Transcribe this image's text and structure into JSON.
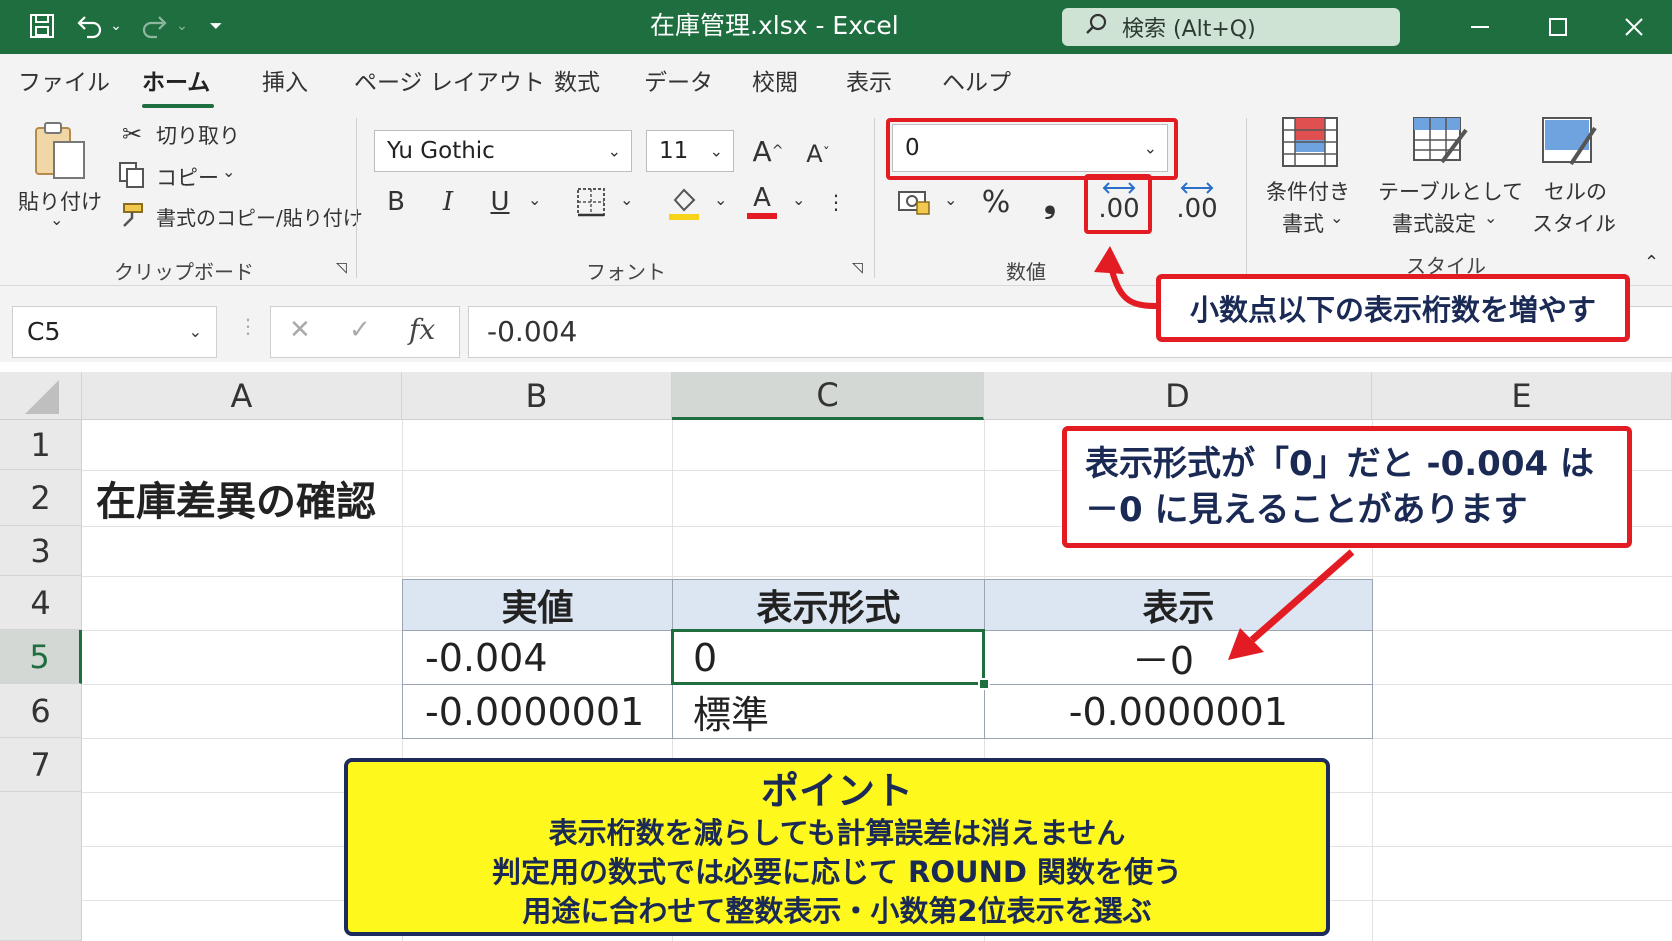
{
  "titlebar": {
    "title": "在庫管理.xlsx  -  Excel",
    "search_label": "検索 (Alt+Q)",
    "icons": [
      "save-icon",
      "undo-icon",
      "redo-icon",
      "customize-icon",
      "search-icon",
      "minimize-icon",
      "maximize-icon",
      "close-icon"
    ]
  },
  "tabs": [
    "ファイル",
    "ホーム",
    "挿入",
    "ページ レイアウト",
    "数式",
    "データ",
    "校閲",
    "表示",
    "ヘルプ"
  ],
  "ribbon": {
    "clipboard": {
      "paste": "貼り付け",
      "cut": "切り取り",
      "copy": "コピー",
      "format_painter": "書式のコピー/貼り付け",
      "group": "クリップボード"
    },
    "font": {
      "font_name": "Yu Gothic",
      "font_size": "11",
      "group": "フォント",
      "bold": "B",
      "italic": "I",
      "underline": "U"
    },
    "number": {
      "format_value": "0",
      "percent": "%",
      "comma": "❟",
      "increase_decimal": ".00",
      "decrease_decimal": ".00",
      "group": "数値"
    },
    "styles": {
      "conditional_line1": "条件付き",
      "conditional_line2": "書式",
      "table_line1": "テーブルとして",
      "table_line2": "書式設定",
      "cell_line1": "セルの",
      "cell_line2": "スタイル",
      "group": "スタイル"
    }
  },
  "formula_bar": {
    "name_box": "C5",
    "cancel": "✕",
    "enter": "✓",
    "fx": "fx",
    "value": "-0.004"
  },
  "sheet": {
    "columns": [
      "A",
      "B",
      "C",
      "D",
      "E"
    ],
    "rows": [
      "1",
      "2",
      "3",
      "4",
      "5",
      "6",
      "7"
    ],
    "title": "在庫差異の確認",
    "table": {
      "headers": [
        "実値",
        "表示形式",
        "表示"
      ],
      "rows": [
        [
          "-0.004",
          "0",
          "－0"
        ],
        [
          "-0.0000001",
          "標準",
          "-0.0000001"
        ]
      ]
    }
  },
  "annotations": {
    "ribbon_callout": "小数点以下の表示桁数を増やす",
    "cell_callout_line1": "表示形式が「0」だと -0.004 は",
    "cell_callout_line2": "－0 に見えることがあります",
    "point_title": "ポイント",
    "point_lines": [
      "表示桁数を減らしても計算誤差は消えません",
      "判定用の数式では必要に応じて ROUND 関数を使う",
      "用途に合わせて整数表示・小数第2位表示を選ぶ"
    ],
    "colors": {
      "red": "#e31b23",
      "navy": "#1a2a55",
      "yellow": "#fff81c",
      "excel_green": "#1e6e3f"
    }
  }
}
